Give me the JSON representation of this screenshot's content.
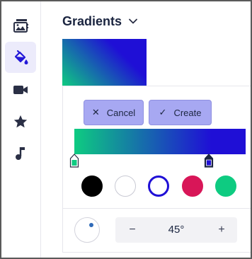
{
  "panel": {
    "title": "Gradients"
  },
  "sidebar": {
    "items": [
      {
        "icon": "media-library-icon",
        "active": false
      },
      {
        "icon": "paint-bucket-icon",
        "active": true
      },
      {
        "icon": "video-camera-icon",
        "active": false
      },
      {
        "icon": "star-icon",
        "active": false
      },
      {
        "icon": "music-note-icon",
        "active": false
      }
    ]
  },
  "gradient": {
    "stops": [
      {
        "color": "#0ecb81",
        "position": 0
      },
      {
        "color": "#1f0fd6",
        "position": 0.8
      }
    ],
    "angle_label": "45°"
  },
  "actions": {
    "cancel_label": "Cancel",
    "create_label": "Create"
  },
  "swatches": [
    {
      "name": "black",
      "color": "#000000"
    },
    {
      "name": "white",
      "color": "#ffffff"
    },
    {
      "name": "blue",
      "color": "#1f0fd6",
      "selected": true
    },
    {
      "name": "crimson",
      "color": "#d81658"
    },
    {
      "name": "green",
      "color": "#0ecb81"
    }
  ],
  "stepper": {
    "minus": "−",
    "plus": "+"
  },
  "colors": {
    "accent": "#a7a8f2",
    "active_rail": "#ecebfb"
  }
}
